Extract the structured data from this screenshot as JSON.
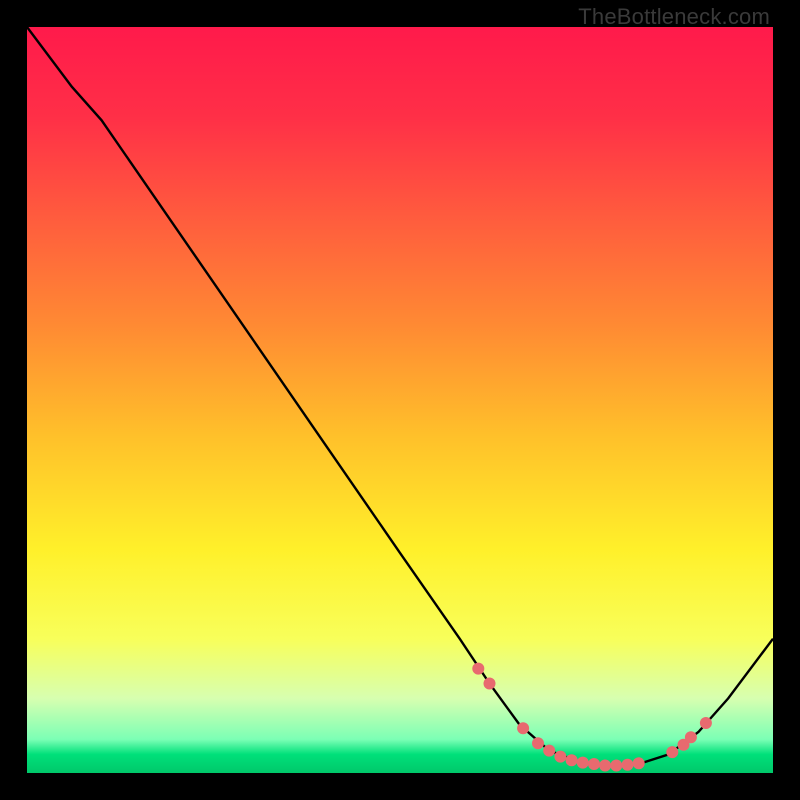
{
  "watermark": "TheBottleneck.com",
  "chart_data": {
    "type": "line",
    "title": "",
    "xlabel": "",
    "ylabel": "",
    "xlim": [
      0,
      100
    ],
    "ylim": [
      0,
      100
    ],
    "grid": false,
    "background_gradient": {
      "stops": [
        {
          "pos": 0.0,
          "color": "#ff1a4b"
        },
        {
          "pos": 0.12,
          "color": "#ff2f47"
        },
        {
          "pos": 0.25,
          "color": "#ff5a3e"
        },
        {
          "pos": 0.4,
          "color": "#ff8a33"
        },
        {
          "pos": 0.55,
          "color": "#ffc12a"
        },
        {
          "pos": 0.7,
          "color": "#fff02a"
        },
        {
          "pos": 0.82,
          "color": "#f8ff5a"
        },
        {
          "pos": 0.9,
          "color": "#d7ffb0"
        },
        {
          "pos": 0.955,
          "color": "#7bffb5"
        },
        {
          "pos": 0.975,
          "color": "#00e07a"
        },
        {
          "pos": 1.0,
          "color": "#00c86a"
        }
      ]
    },
    "curve": [
      {
        "x": 0.0,
        "y": 100.0
      },
      {
        "x": 6.0,
        "y": 92.0
      },
      {
        "x": 10.0,
        "y": 87.5
      },
      {
        "x": 20.0,
        "y": 73.0
      },
      {
        "x": 30.0,
        "y": 58.5
      },
      {
        "x": 40.0,
        "y": 44.0
      },
      {
        "x": 50.0,
        "y": 29.5
      },
      {
        "x": 58.0,
        "y": 18.0
      },
      {
        "x": 62.0,
        "y": 12.0
      },
      {
        "x": 66.0,
        "y": 6.5
      },
      {
        "x": 70.0,
        "y": 3.0
      },
      {
        "x": 74.0,
        "y": 1.5
      },
      {
        "x": 78.0,
        "y": 1.0
      },
      {
        "x": 82.0,
        "y": 1.2
      },
      {
        "x": 86.0,
        "y": 2.5
      },
      {
        "x": 90.0,
        "y": 5.5
      },
      {
        "x": 94.0,
        "y": 10.0
      },
      {
        "x": 100.0,
        "y": 18.0
      }
    ],
    "markers": [
      {
        "x": 60.5,
        "y": 14.0
      },
      {
        "x": 62.0,
        "y": 12.0
      },
      {
        "x": 66.5,
        "y": 6.0
      },
      {
        "x": 68.5,
        "y": 4.0
      },
      {
        "x": 70.0,
        "y": 3.0
      },
      {
        "x": 71.5,
        "y": 2.2
      },
      {
        "x": 73.0,
        "y": 1.7
      },
      {
        "x": 74.5,
        "y": 1.4
      },
      {
        "x": 76.0,
        "y": 1.2
      },
      {
        "x": 77.5,
        "y": 1.0
      },
      {
        "x": 79.0,
        "y": 1.0
      },
      {
        "x": 80.5,
        "y": 1.1
      },
      {
        "x": 82.0,
        "y": 1.3
      },
      {
        "x": 86.5,
        "y": 2.8
      },
      {
        "x": 88.0,
        "y": 3.8
      },
      {
        "x": 89.0,
        "y": 4.8
      },
      {
        "x": 91.0,
        "y": 6.7
      }
    ],
    "marker_color": "#e86a6f",
    "line_color": "#000000"
  }
}
